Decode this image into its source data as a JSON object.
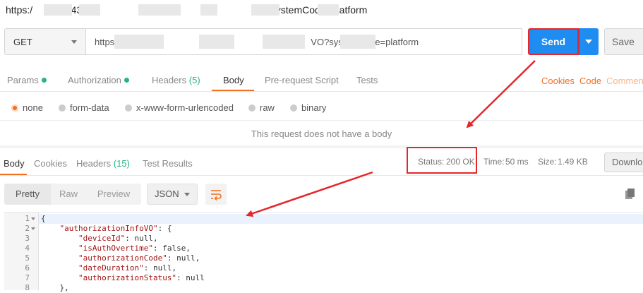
{
  "title_url": "https:/              43/d                                                             O?systemCode=platform",
  "request": {
    "method": "GET",
    "url": "https                                                                             VO?systemCode=platform",
    "send_label": "Send",
    "save_label": "Save"
  },
  "req_tabs": {
    "params": "Params",
    "authorization": "Authorization",
    "headers": "Headers",
    "headers_count": "(5)",
    "body": "Body",
    "prerequest": "Pre-request Script",
    "tests": "Tests",
    "cookies": "Cookies",
    "code": "Code",
    "comments": "Commen"
  },
  "body_modes": [
    "none",
    "form-data",
    "x-www-form-urlencoded",
    "raw",
    "binary"
  ],
  "no_body_text": "This request does not have a body",
  "resp_tabs": {
    "body": "Body",
    "cookies": "Cookies",
    "headers": "Headers",
    "headers_count": "(15)",
    "test_results": "Test Results"
  },
  "status": {
    "status_label": "Status:",
    "status_value": "200 OK",
    "time_label": "Time:",
    "time_value": "50 ms",
    "size_label": "Size:",
    "size_value": "1.49 KB",
    "download_label": "Downlo"
  },
  "format": {
    "pretty": "Pretty",
    "raw": "Raw",
    "preview": "Preview",
    "json": "JSON"
  },
  "code_lines": [
    {
      "n": "1",
      "text": "{"
    },
    {
      "n": "2",
      "text": "    \"authorizationInfoVO\": {"
    },
    {
      "n": "3",
      "text": "        \"deviceId\": null,"
    },
    {
      "n": "4",
      "text": "        \"isAuthOvertime\": false,"
    },
    {
      "n": "5",
      "text": "        \"authorizationCode\": null,"
    },
    {
      "n": "6",
      "text": "        \"dateDuration\": null,"
    },
    {
      "n": "7",
      "text": "        \"authorizationStatus\": null"
    },
    {
      "n": "8",
      "text": "    },"
    }
  ],
  "colors": {
    "accent": "#f47023",
    "send_blue": "#1e8cf0",
    "status_green": "#26b47f",
    "annotation_red": "#e5262b"
  }
}
